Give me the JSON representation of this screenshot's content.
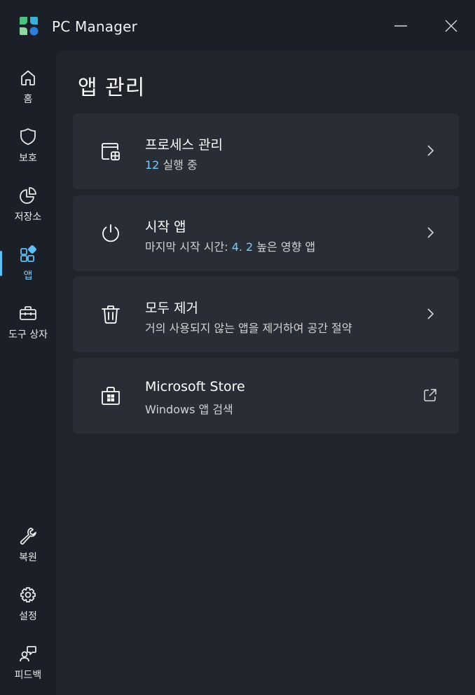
{
  "app": {
    "title": "PC Manager"
  },
  "sidebar": {
    "items": [
      {
        "label": "홈",
        "icon": "home-icon"
      },
      {
        "label": "보호",
        "icon": "shield-icon"
      },
      {
        "label": "저장소",
        "icon": "pie-chart-icon"
      },
      {
        "label": "앱",
        "icon": "apps-icon",
        "active": true
      },
      {
        "label": "도구 상자",
        "icon": "toolbox-icon"
      },
      {
        "label": "복원",
        "icon": "wrench-icon"
      },
      {
        "label": "설정",
        "icon": "gear-icon"
      },
      {
        "label": "피드백",
        "icon": "feedback-icon"
      }
    ]
  },
  "main": {
    "title": "앱 관리",
    "cards": [
      {
        "title": "프로세스 관리",
        "sub_highlight": "12",
        "sub_text": " 실행 중",
        "icon": "process-icon",
        "action_icon": "chevron-right-icon"
      },
      {
        "title": "시작 앱",
        "sub_prefix": "마지막 시작 시간: ",
        "sub_highlight": "4. 2",
        "sub_suffix": " 높은 영향 앱",
        "icon": "power-icon",
        "action_icon": "chevron-right-icon"
      },
      {
        "title": "모두 제거",
        "sub_text": "거의 사용되지 않는 앱을 제거하여 공간 절약",
        "icon": "trash-icon",
        "action_icon": "chevron-right-icon"
      },
      {
        "title": "Microsoft Store",
        "sub_text": "Windows 앱 검색",
        "icon": "store-icon",
        "action_icon": "external-link-icon"
      }
    ]
  },
  "colors": {
    "accent": "#60c0f5",
    "background": "#1b1f27",
    "content": "#20242b",
    "card": "#292d35"
  }
}
